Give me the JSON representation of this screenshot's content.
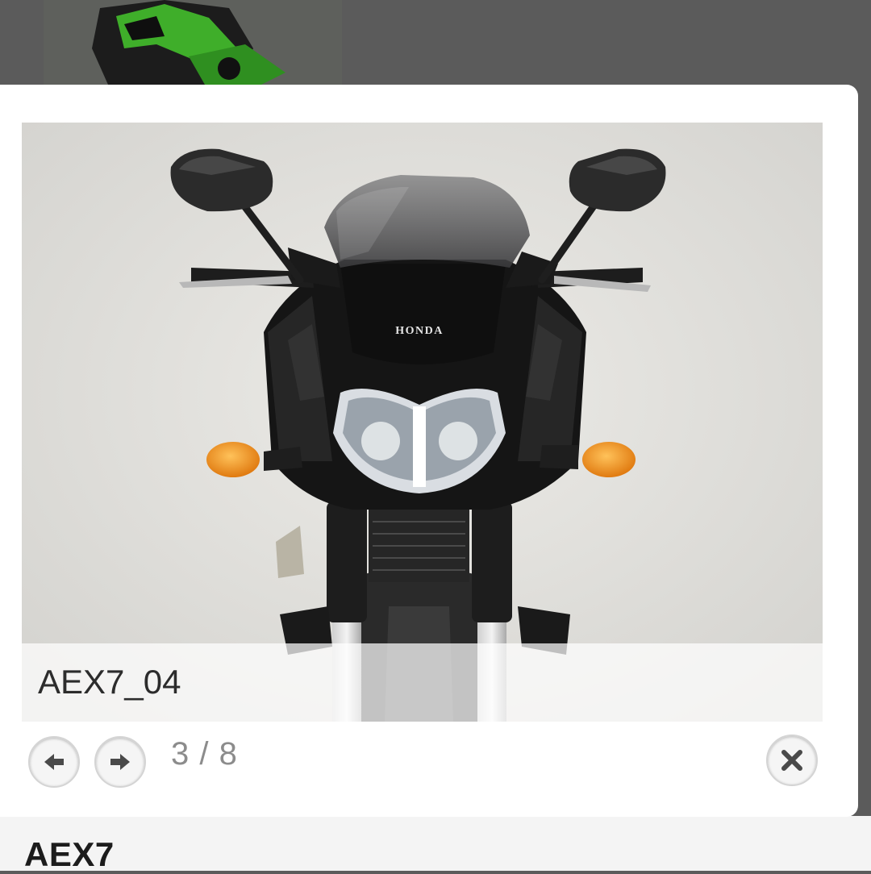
{
  "lightbox": {
    "caption": "AEX7_04",
    "counter": "3 / 8",
    "prev_icon": "arrow-left-icon",
    "next_icon": "arrow-right-icon",
    "close_icon": "close-icon"
  },
  "photo": {
    "brand_text": "HONDA"
  },
  "page": {
    "model_title": "AEX7"
  },
  "colors": {
    "overlay": "#5b5b5b",
    "photo_bg": "#e7e6e2",
    "bike_body": "#151515",
    "indicator": "#f39a1c",
    "thumb_green": "#3fae2a"
  }
}
